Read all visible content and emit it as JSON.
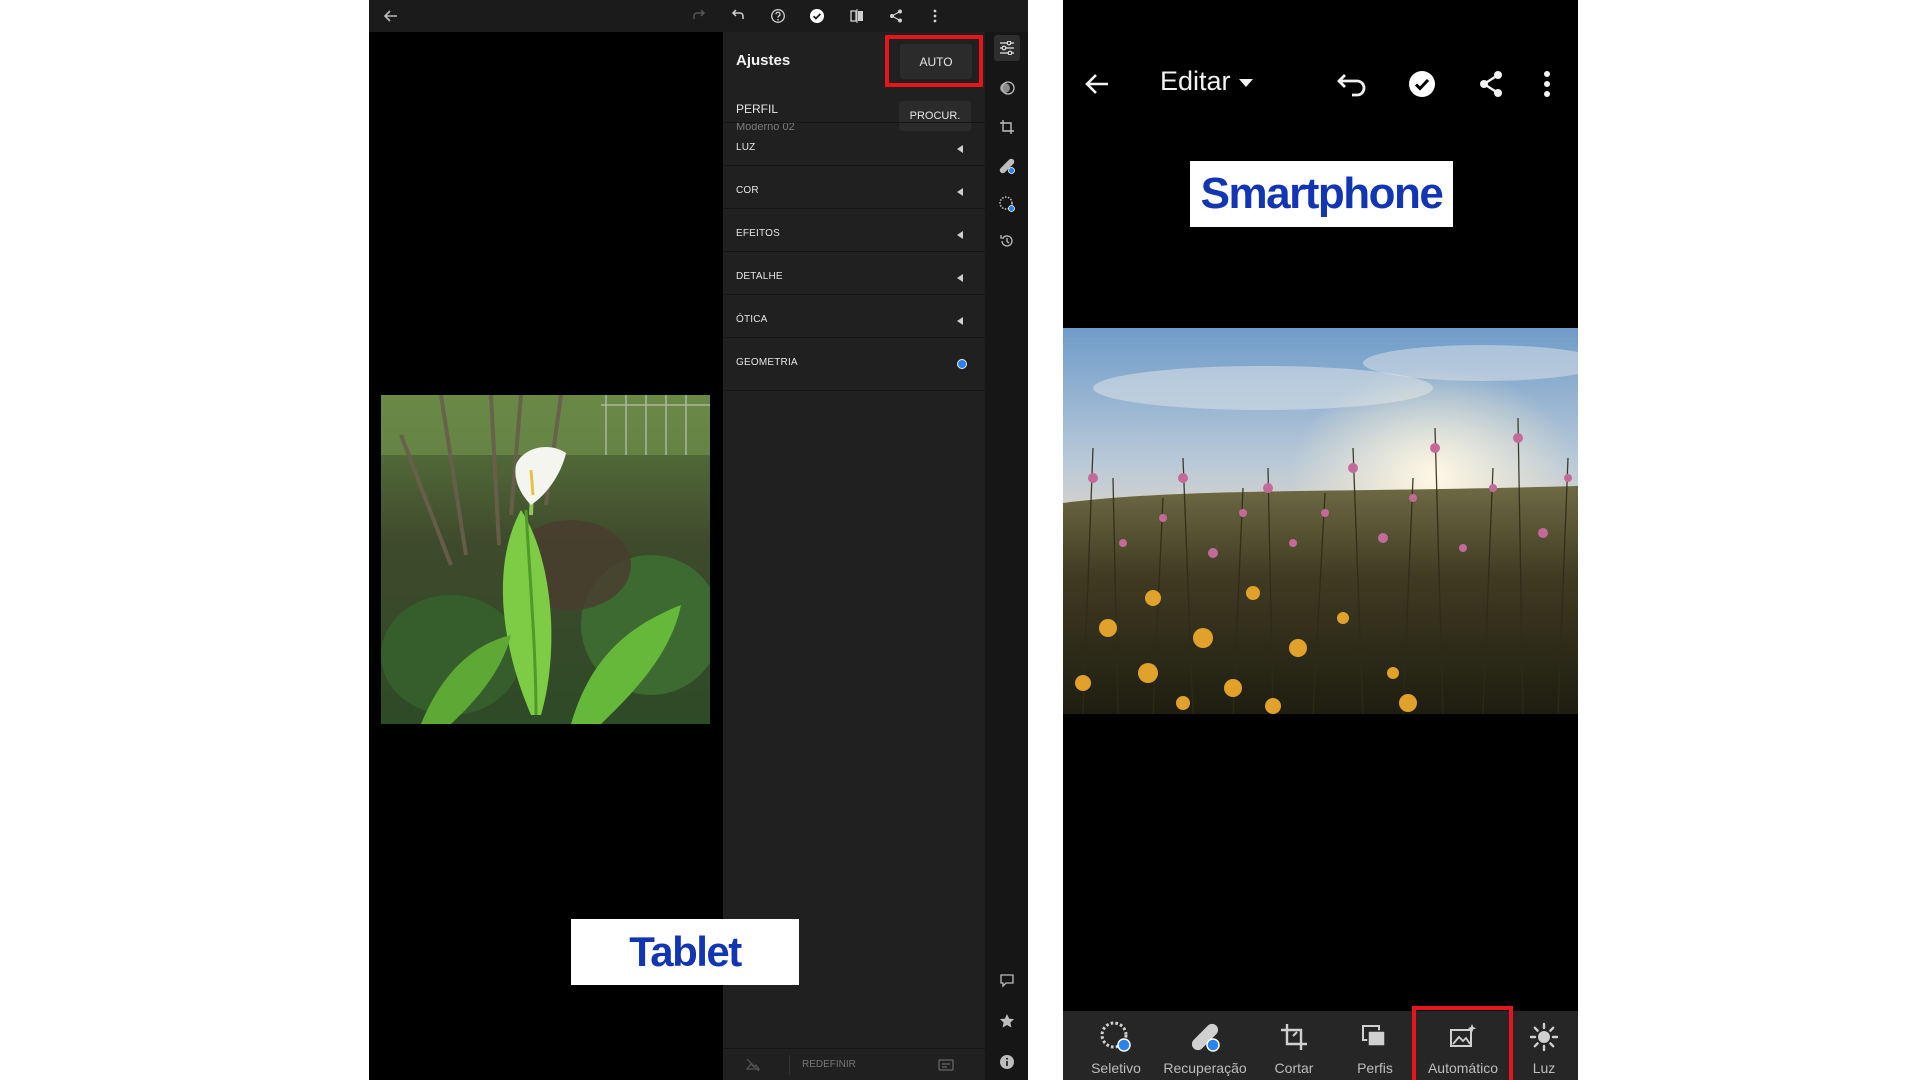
{
  "tablet": {
    "label": "Tablet",
    "panel": {
      "title": "Ajustes",
      "auto_label": "AUTO",
      "profile_label": "PERFIL",
      "profile_value": "Moderno 02",
      "browse_label": "PROCUR.",
      "sections": [
        {
          "label": "LUZ",
          "indicator": "chevron-left"
        },
        {
          "label": "COR",
          "indicator": "chevron-left"
        },
        {
          "label": "EFEITOS",
          "indicator": "chevron-left"
        },
        {
          "label": "DETALHE",
          "indicator": "chevron-left"
        },
        {
          "label": "ÓTICA",
          "indicator": "chevron-left"
        },
        {
          "label": "GEOMETRIA",
          "indicator": "blue-dot"
        }
      ],
      "reset_label": "REDEFINIR"
    },
    "topbar_icons": [
      "back-arrow-icon",
      "redo-icon",
      "undo-icon",
      "help-icon",
      "checkmark-icon",
      "compare-icon",
      "share-icon",
      "more-icon"
    ],
    "rail_icons": [
      "adjustments-sliders-icon",
      "presets-icon",
      "crop-icon",
      "healing-icon",
      "selective-icon",
      "history-icon",
      "comment-icon",
      "star-icon",
      "info-icon"
    ],
    "highlight_color": "#e8141b"
  },
  "phone": {
    "label": "Smartphone",
    "header": {
      "title": "Editar",
      "icons": [
        "back-arrow-icon",
        "undo-icon",
        "checkmark-icon",
        "share-icon",
        "more-icon"
      ]
    },
    "toolbar": [
      {
        "label": "Seletivo",
        "icon": "selective-icon"
      },
      {
        "label": "Recuperação",
        "icon": "healing-icon"
      },
      {
        "label": "Cortar",
        "icon": "crop-icon"
      },
      {
        "label": "Perfis",
        "icon": "profiles-icon"
      },
      {
        "label": "Automático",
        "icon": "auto-icon",
        "highlighted": true
      },
      {
        "label": "Luz",
        "icon": "light-icon"
      }
    ],
    "highlight_color": "#e8141b"
  },
  "brand_label_color": "#1235b3"
}
